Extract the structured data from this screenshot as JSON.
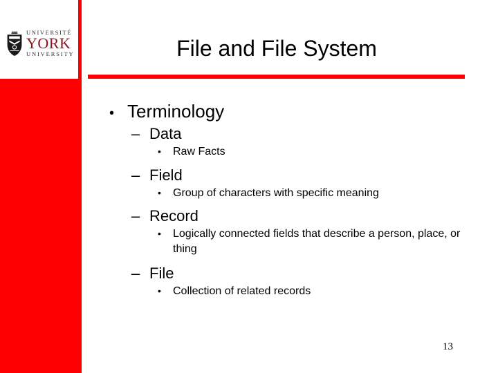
{
  "slide": {
    "title": "File and File System",
    "slide_number": "13",
    "accent_color": "#FF0000",
    "logo_text_color": "#8B1520",
    "text_color": "#000000",
    "background_color": "#FFFFFF"
  },
  "logo": {
    "icon": "york-university-crest-icon",
    "line1": "UNIVERSITÉ",
    "line2": "YORK",
    "line3": "UNIVERSITY"
  },
  "content": {
    "l1_bullet_mark": "•",
    "l2_bullet_mark": "–",
    "l3_bullet_mark": "•",
    "items": [
      {
        "level": 1,
        "text": "Terminology"
      },
      {
        "level": 2,
        "text": "Data"
      },
      {
        "level": 3,
        "text": "Raw Facts"
      },
      {
        "level": 2,
        "text": "Field"
      },
      {
        "level": 3,
        "text": "Group of characters with specific meaning"
      },
      {
        "level": 2,
        "text": "Record"
      },
      {
        "level": 3,
        "text": "Logically connected fields that describe a person, place, or thing"
      },
      {
        "level": 2,
        "text": "File"
      },
      {
        "level": 3,
        "text": "Collection of related records"
      }
    ]
  }
}
